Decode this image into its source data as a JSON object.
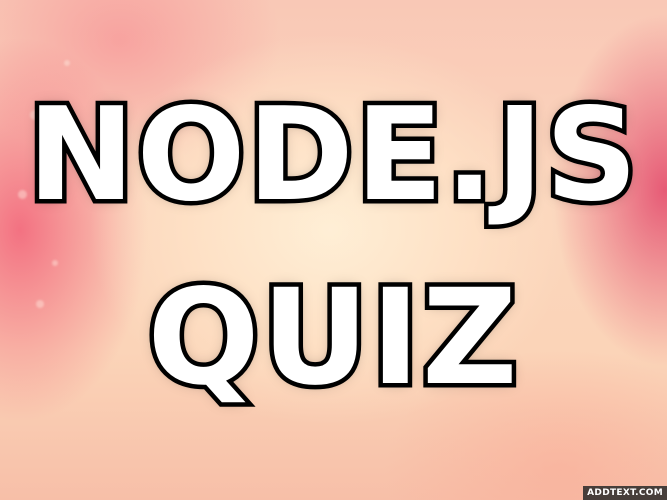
{
  "image": {
    "title_line_1": "NODE.JS",
    "title_line_2": "QUIZ",
    "watermark": "ADDTEXT.COM",
    "colors": {
      "text_fill": "#ffffff",
      "text_outline": "#000000",
      "background_center": "#fde6c8",
      "background_edges": "#ef5f7a"
    }
  }
}
